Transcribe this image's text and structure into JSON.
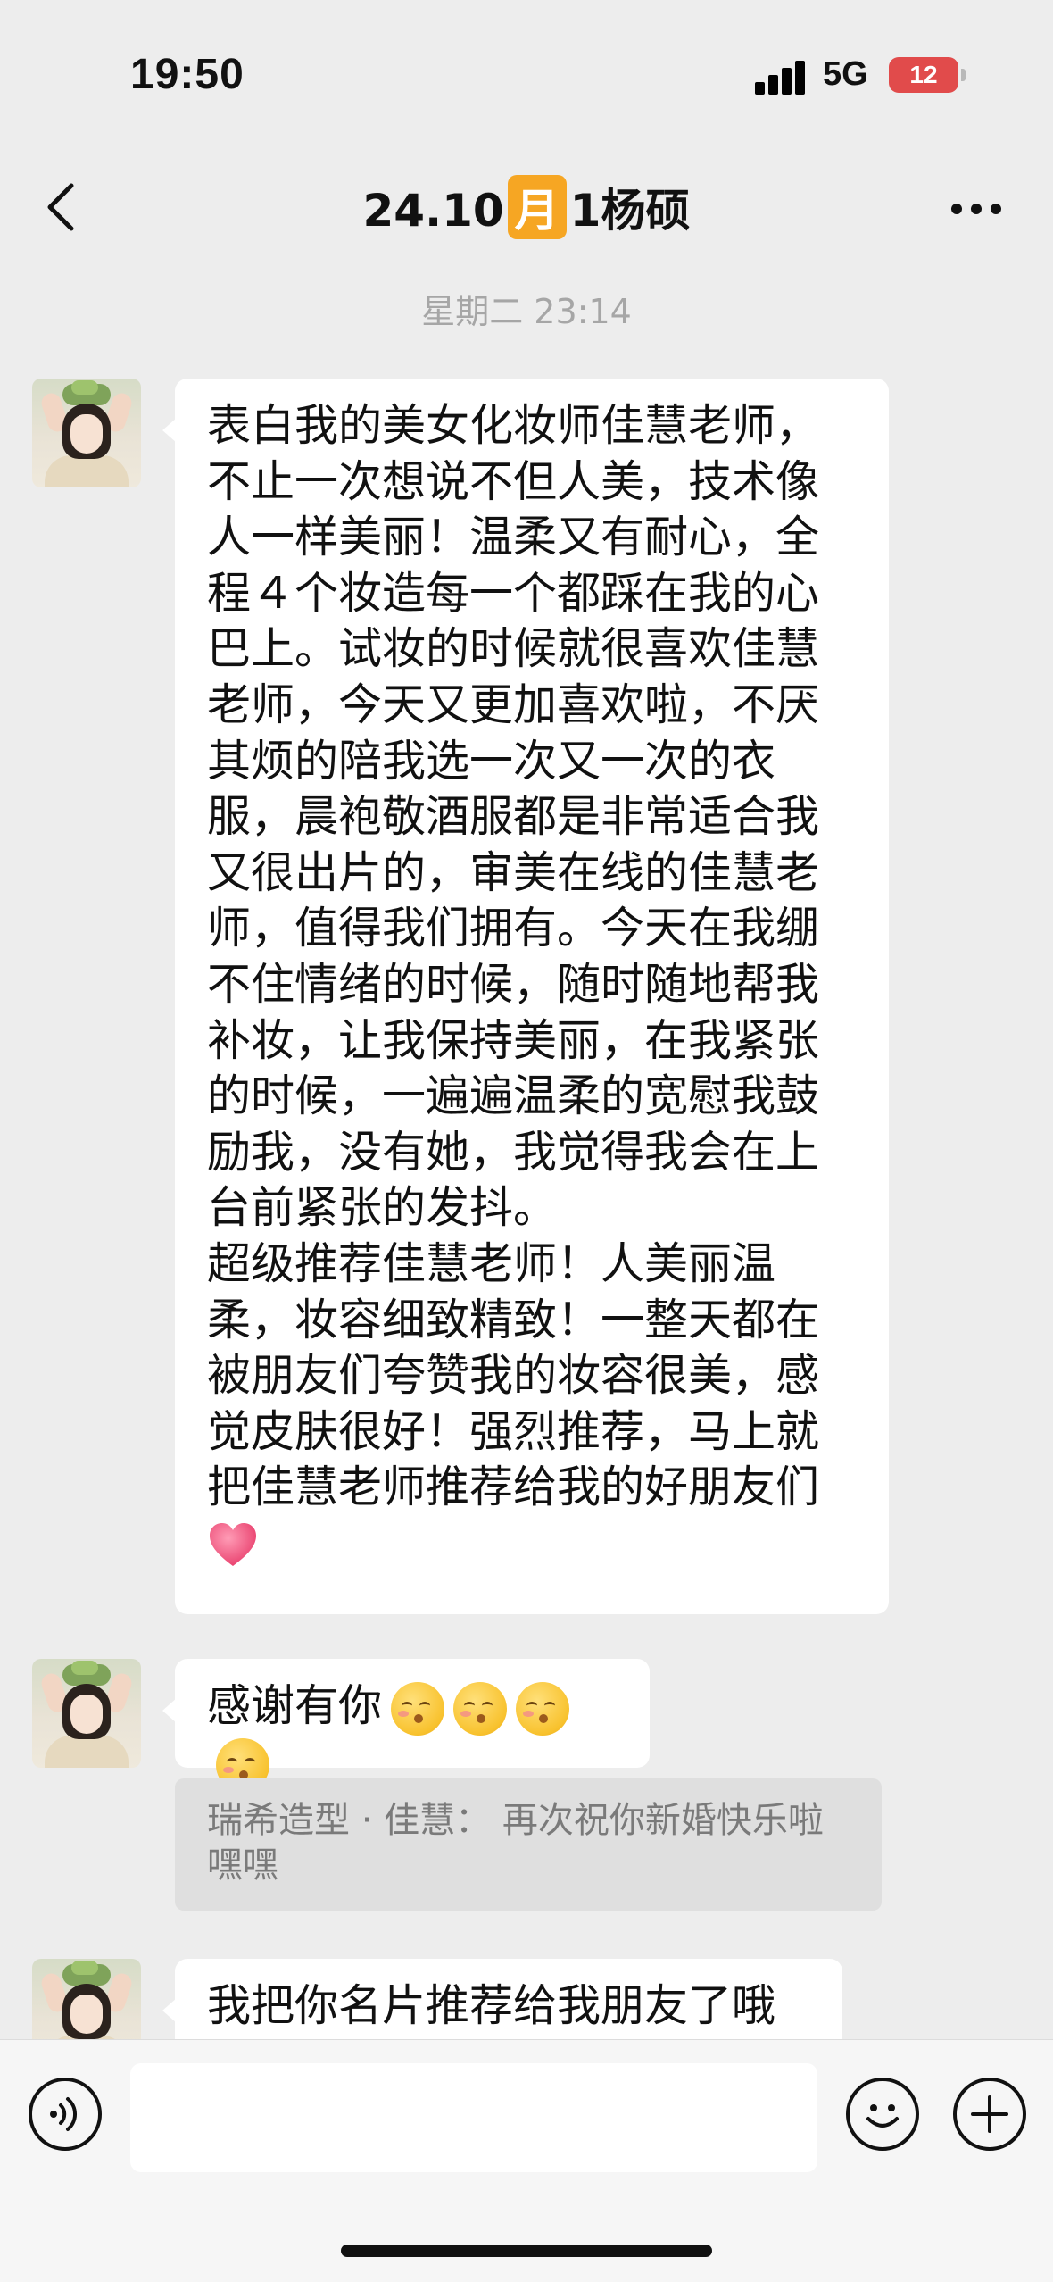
{
  "status_bar": {
    "time": "19:50",
    "network": "5G",
    "battery": "12"
  },
  "header": {
    "title_prefix": "24.10",
    "title_highlight": "月",
    "title_suffix": "1杨硕"
  },
  "timestamp": "星期二 23:14",
  "messages": [
    {
      "lines": [
        "表白我的美女化妆师佳慧老师，",
        "不止一次想说不但人美，技术像",
        "人一样美丽！温柔又有耐心，全",
        "程４个妆造每一个都踩在我的心",
        "巴上。试妆的时候就很喜欢佳慧",
        "老师，今天又更加喜欢啦，不厌",
        "其烦的陪我选一次又一次的衣",
        "服，晨袍敬酒服都是非常适合我",
        "又很出片的，审美在线的佳慧老",
        "师，值得我们拥有。今天在我绷",
        "不住情绪的时候，随时随地帮我",
        "补妆，让我保持美丽，在我紧张",
        "的时候，一遍遍温柔的宽慰我鼓",
        "励我，没有她，我觉得我会在上",
        "台前紧张的发抖。",
        "超级推荐佳慧老师！人美丽温",
        "柔，妆容细致精致！一整天都在",
        "被朋友们夸赞我的妆容很美，感",
        "觉皮肤很好！强烈推荐，马上就",
        "把佳慧老师推荐给我的好朋友们"
      ]
    },
    {
      "text": "感谢有你"
    },
    {
      "text": "我把你名片推荐给我朋友了哦"
    }
  ],
  "quote": {
    "line1": "瑞希造型 · 佳慧：  再次祝你新婚快乐啦",
    "line2": "嘿嘿"
  },
  "colors": {
    "accent": "#f6a623",
    "battery": "#e14b4b",
    "background": "#ededed"
  },
  "icons": [
    "back-icon",
    "more-icon",
    "voice-icon",
    "emoji-icon",
    "plus-icon",
    "heart-icon",
    "kissing-face-icon"
  ]
}
